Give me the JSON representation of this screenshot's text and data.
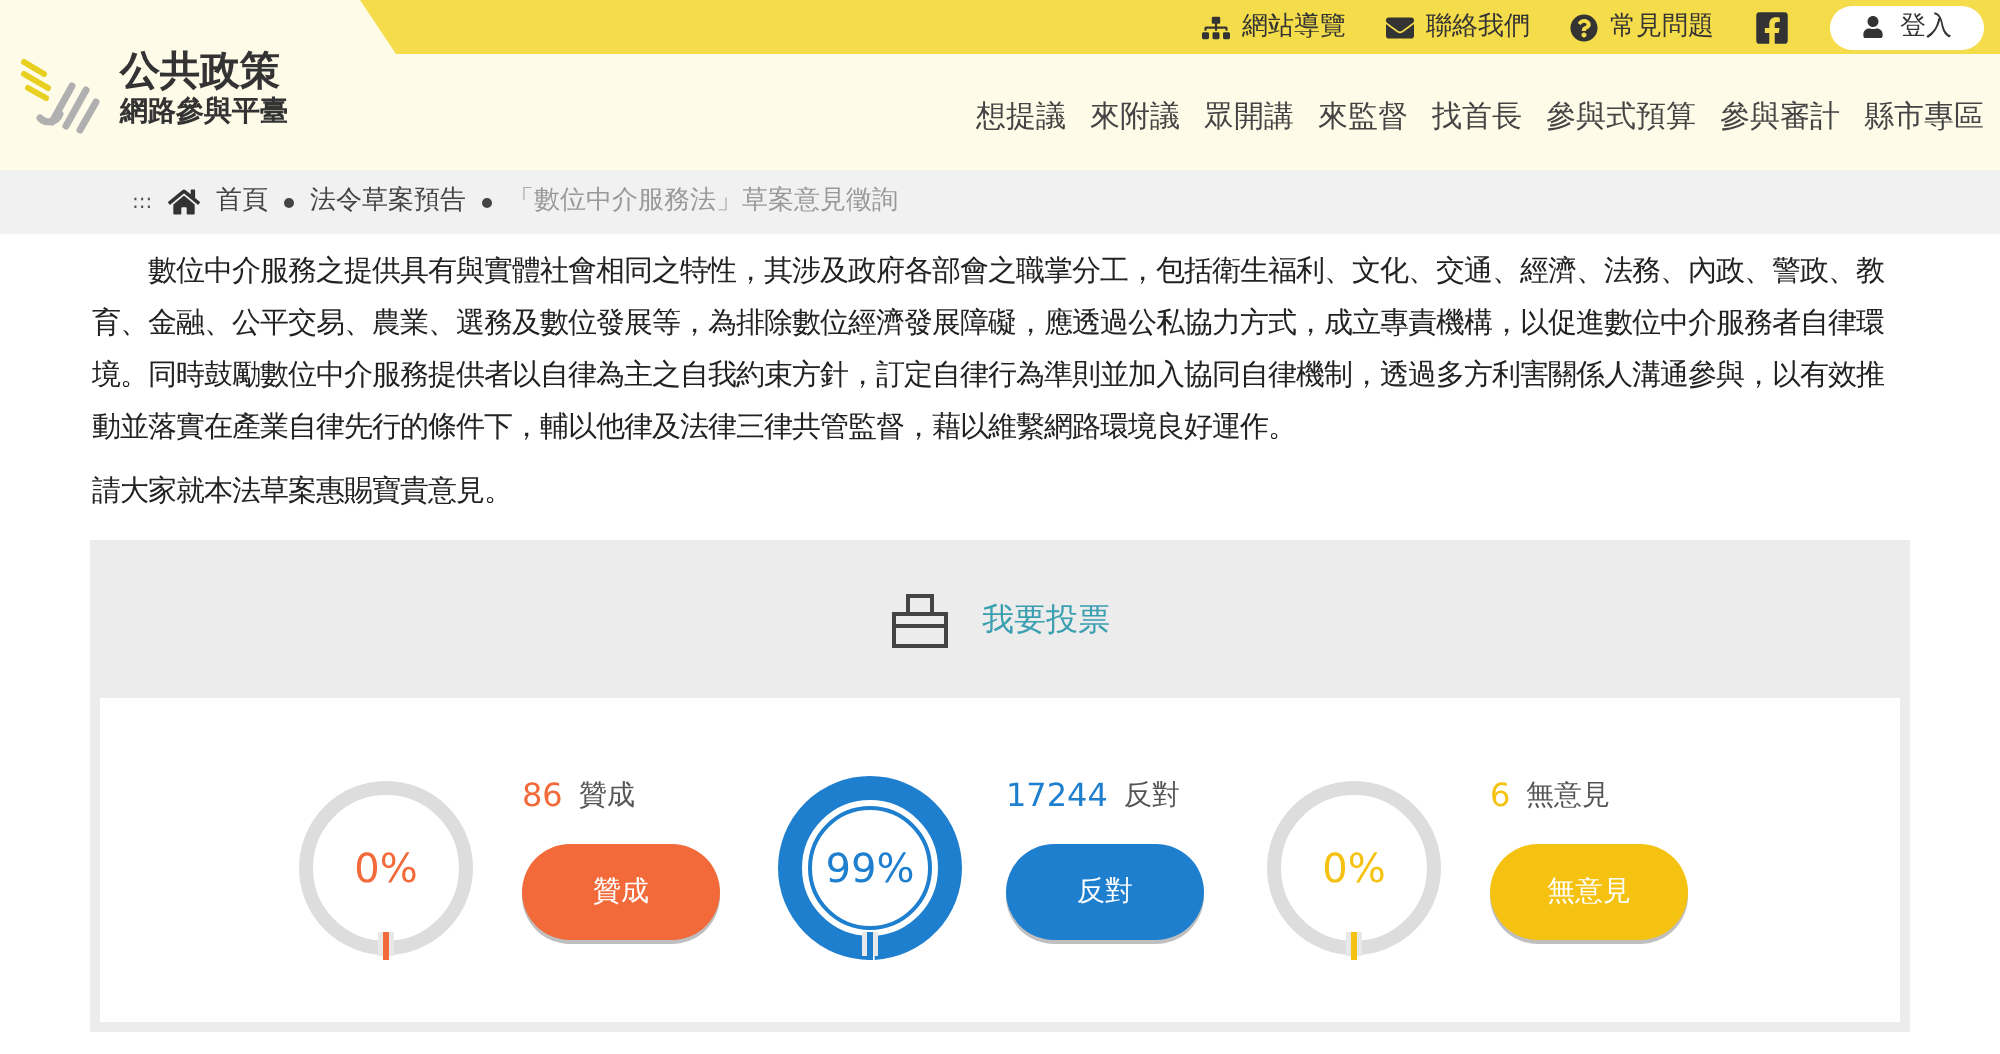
{
  "site": {
    "title": "公共政策",
    "subtitle": "網路參與平臺"
  },
  "top_links": [
    {
      "kind": "sitemap",
      "label": "網站導覽"
    },
    {
      "kind": "mail",
      "label": "聯絡我們"
    },
    {
      "kind": "help",
      "label": "常見問題"
    },
    {
      "kind": "facebook"
    },
    {
      "kind": "login",
      "label": "登入"
    }
  ],
  "nav": [
    "想提議",
    "來附議",
    "眾開講",
    "來監督",
    "找首長",
    "參與式預算",
    "參與審計",
    "縣市專區"
  ],
  "breadcrumb": {
    "menu": ":::",
    "items": [
      "首頁",
      "法令草案預告",
      "「數位中介服務法」草案意見徵詢"
    ]
  },
  "paragraphs": [
    "數位中介服務之提供具有與實體社會相同之特性，其涉及政府各部會之職掌分工，包括衛生福利、文化、交通、經濟、法務、內政、警政、教育、金融、公平交易、農業、選務及數位發展等，為排除數位經濟發展障礙，應透過公私協力方式，成立專責機構，以促進數位中介服務者自律環境。同時鼓勵數位中介服務提供者以自律為主之自我約束方針，訂定自律行為準則並加入協同自律機制，透過多方利害關係人溝通參與，以有效推動並落實在產業自律先行的條件下，輔以他律及法律三律共管監督，藉以維繫網路環境良好運作。",
    "請大家就本法草案惠賜寶貴意見。"
  ],
  "vote": {
    "title": "我要投票",
    "options": [
      {
        "percent": "0%",
        "kind": "empty",
        "count": "86",
        "label": "贊成",
        "button": "贊成",
        "color": "#f26a3a"
      },
      {
        "percent": "99%",
        "kind": "full",
        "count": "17244",
        "label": "反對",
        "button": "反對",
        "color": "#1f7fcf"
      },
      {
        "percent": "0%",
        "kind": "empty",
        "count": "6",
        "label": "無意見",
        "button": "無意見",
        "color": "#f5c211"
      }
    ]
  }
}
